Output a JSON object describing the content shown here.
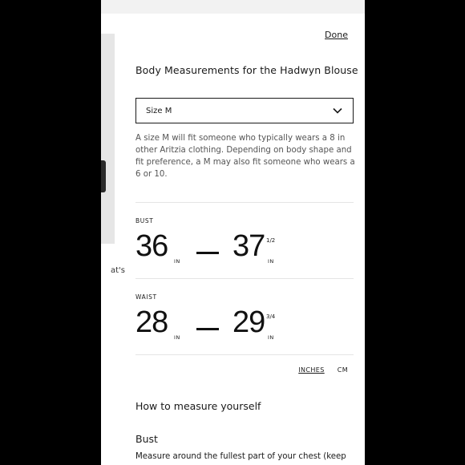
{
  "panel": {
    "done_label": "Done",
    "title": "Body Measurements for the Hadwyn Blouse",
    "size_select": {
      "value": "Size M",
      "icon": "chevron-down-icon"
    },
    "description": "A size M will fit someone who typically wears a 8 in other Aritzia clothing. Depending on body shape and fit preference, a M may also fit someone who wears a 6 or 10.",
    "measurements": [
      {
        "label": "BUST",
        "low": "36",
        "low_unit": "IN",
        "high": "37",
        "high_fraction": "1/2",
        "high_unit": "IN"
      },
      {
        "label": "WAIST",
        "low": "28",
        "low_unit": "IN",
        "high": "29",
        "high_fraction": "3/4",
        "high_unit": "IN"
      }
    ],
    "units": {
      "inches": "INCHES",
      "cm": "CM",
      "selected": "INCHES"
    },
    "how_to_title": "How to measure yourself",
    "bust_heading": "Bust",
    "bust_text": "Measure around the fullest part of your chest (keep"
  },
  "background_page": {
    "partial_text": "at's"
  }
}
